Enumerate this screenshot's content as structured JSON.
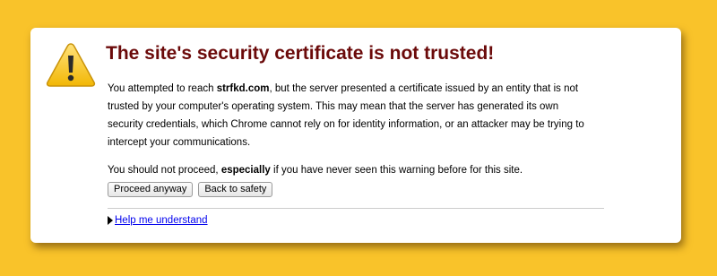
{
  "page": {
    "background_color": "#F9C32A",
    "title_color": "#6B0A0A",
    "link_color": "#0000EE"
  },
  "warning": {
    "icon": "warning-triangle-icon",
    "title": "The site's security certificate is not trusted!",
    "paragraph1": {
      "before": "You attempted to reach ",
      "domain": "strfkd.com",
      "after": ", but the server presented a certificate issued by an entity that is not trusted by your computer's operating system. This may mean that the server has generated its own security credentials, which Chrome cannot rely on for identity information, or an attacker may be trying to intercept your communications."
    },
    "paragraph2": {
      "before": "You should not proceed, ",
      "emphasis": "especially",
      "after": " if you have never seen this warning before for this site."
    }
  },
  "buttons": {
    "proceed_label": "Proceed anyway",
    "back_label": "Back to safety"
  },
  "help": {
    "link_label": "Help me understand"
  }
}
